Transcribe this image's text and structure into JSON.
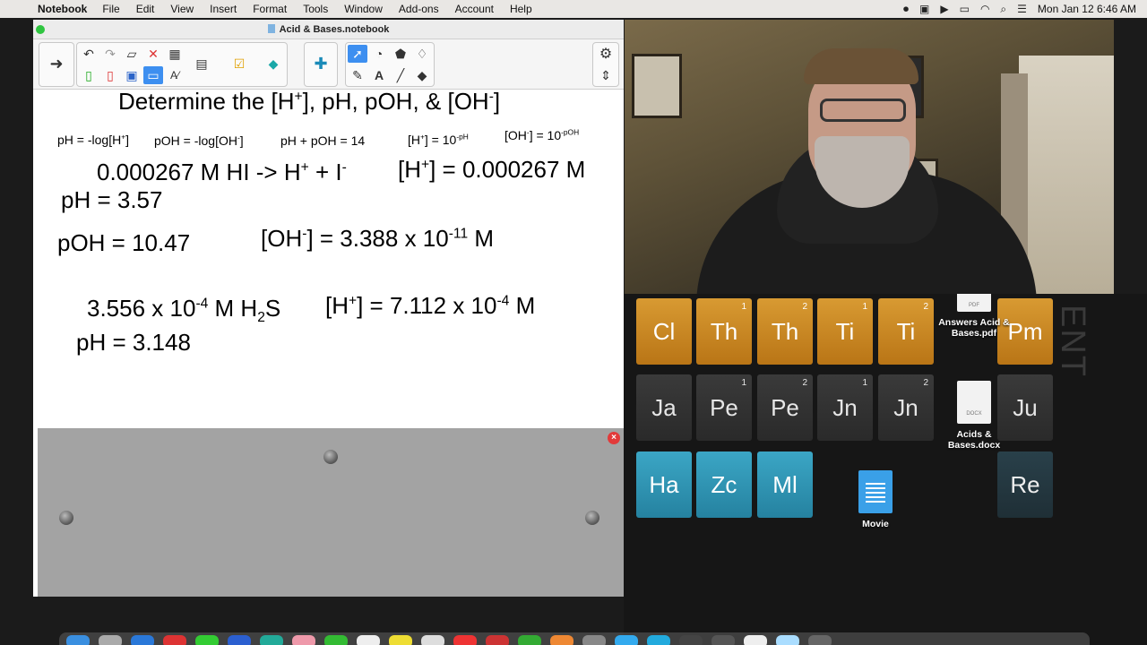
{
  "menubar": {
    "apple": "",
    "app_name": "Notebook",
    "menus": [
      "File",
      "Edit",
      "View",
      "Insert",
      "Format",
      "Tools",
      "Window",
      "Add-ons",
      "Account",
      "Help"
    ],
    "datetime": "Mon Jan 12  6:46 AM"
  },
  "window": {
    "title": "Acid & Bases.notebook"
  },
  "canvas": {
    "heading": "Determine the [H",
    "heading_sup1": "+",
    "heading_mid": "], pH, pOH, & [OH",
    "heading_sup2": "-",
    "heading_end": "]",
    "formulas": {
      "f1": "pH = -log[H",
      "f1_sup": "+",
      "f1_end": "]",
      "f2": "pOH = -log[OH",
      "f2_sup": "-",
      "f2_end": "]",
      "f3": "pH + pOH = 14",
      "f4": "[H",
      "f4_sup": "+",
      "f4_mid": "] = 10",
      "f4_exp": "-pH",
      "f5": "[OH",
      "f5_sup": "-",
      "f5_mid": "] = 10",
      "f5_exp": "-pOH"
    },
    "p1_eq": "0.000267 M HI -> H",
    "p1_eq_sup": "+",
    "p1_eq_mid": " + I",
    "p1_eq_sup2": "-",
    "p1_h": "[H",
    "p1_h_sup": "+",
    "p1_h_end": "] = 0.000267 M",
    "p1_ph": "pH = 3.57",
    "p1_poh": "pOH = 10.47",
    "p1_oh": "[OH",
    "p1_oh_sup": "-",
    "p1_oh_mid": "] = 3.388 x 10",
    "p1_oh_exp": "-11",
    "p1_oh_end": "  M",
    "p2_eq": "3.556 x 10",
    "p2_eq_exp": "-4",
    "p2_eq_mid": " M H",
    "p2_eq_sub": "2",
    "p2_eq_end": "S",
    "p2_h": "[H",
    "p2_h_sup": "+",
    "p2_h_mid": "] = 7.112 x 10",
    "p2_h_exp": "-4",
    "p2_h_end": " M",
    "p2_ph": "pH = 3.148"
  },
  "desktop": {
    "tiles": [
      {
        "sym": "Cl",
        "num": "",
        "style": "gold"
      },
      {
        "sym": "Th",
        "num": "1",
        "style": "gold"
      },
      {
        "sym": "Th",
        "num": "2",
        "style": "gold"
      },
      {
        "sym": "Ti",
        "num": "1",
        "style": "gold"
      },
      {
        "sym": "Ti",
        "num": "2",
        "style": "gold"
      },
      {
        "sym": "Pm",
        "num": "",
        "style": "gold"
      },
      {
        "sym": "Ja",
        "num": "",
        "style": "gray"
      },
      {
        "sym": "Pe",
        "num": "1",
        "style": "gray"
      },
      {
        "sym": "Pe",
        "num": "2",
        "style": "gray"
      },
      {
        "sym": "Jn",
        "num": "1",
        "style": "gray"
      },
      {
        "sym": "Jn",
        "num": "2",
        "style": "gray"
      },
      {
        "sym": "Ju",
        "num": "",
        "style": "gray"
      },
      {
        "sym": "Ha",
        "num": "",
        "style": "blue"
      },
      {
        "sym": "Zc",
        "num": "",
        "style": "blue"
      },
      {
        "sym": "Ml",
        "num": "",
        "style": "blue"
      },
      {
        "sym": "Re",
        "num": "",
        "style": "dark"
      }
    ],
    "vertical_text": "ENT",
    "files": {
      "pdf_label": "Answers Acid & Bases.pdf",
      "pdf_ext": "PDF",
      "docx_label": "Acids & Bases.docx",
      "docx_ext": "DOCX",
      "movie_label": "Movie"
    }
  },
  "colors": {
    "accent": "#3d8ff0",
    "close": "#e23a3a",
    "shade": "#a3a3a3"
  }
}
